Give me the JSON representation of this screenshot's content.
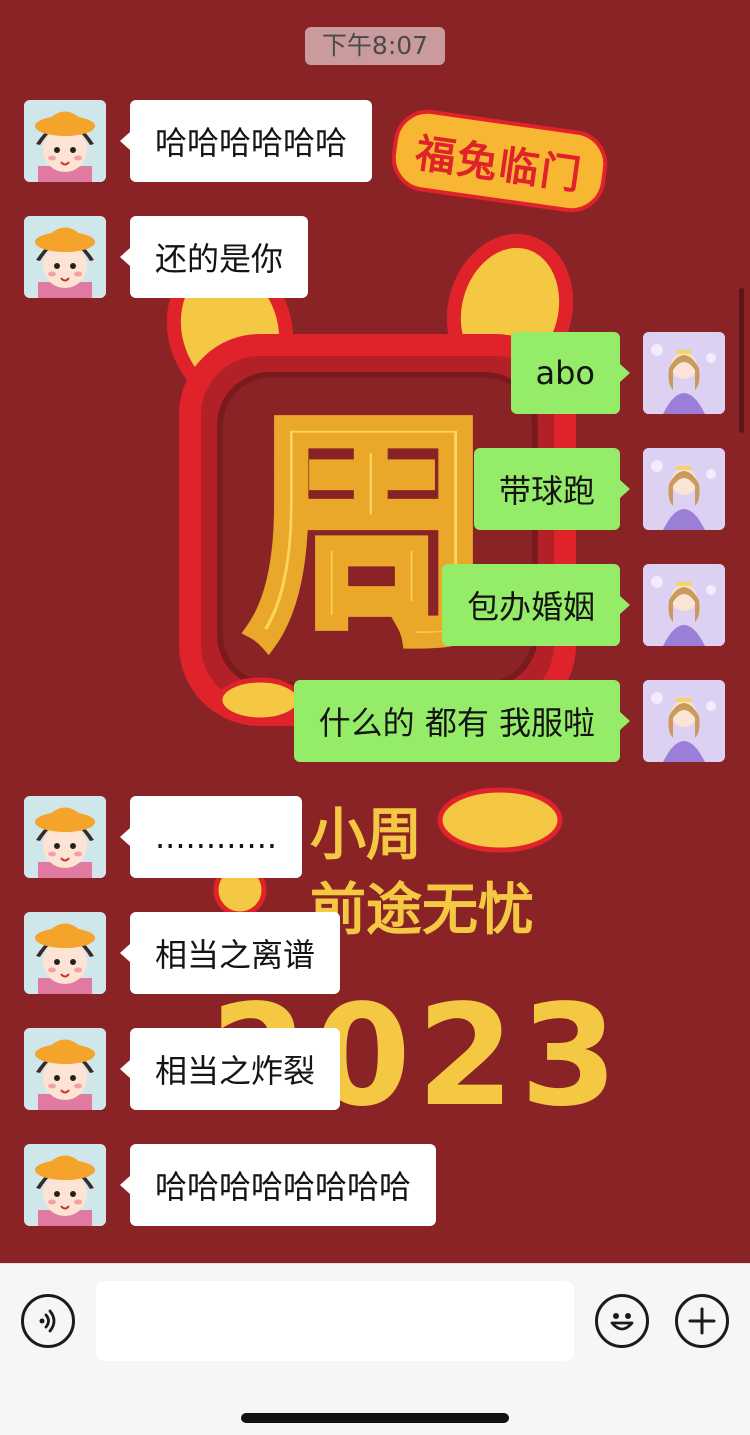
{
  "timestamp": "下午8:07",
  "wallpaper": {
    "badge": "福兔临门",
    "big_char": "周",
    "line1": "小周",
    "line2": "前途无忧",
    "year": "2023"
  },
  "messages": [
    {
      "side": "left",
      "text": "哈哈哈哈哈哈"
    },
    {
      "side": "left",
      "text": "还的是你"
    },
    {
      "side": "right",
      "text": "abo"
    },
    {
      "side": "right",
      "text": "带球跑"
    },
    {
      "side": "right",
      "text": "包办婚姻"
    },
    {
      "side": "right",
      "text": "什么的 都有 我服啦"
    },
    {
      "side": "left",
      "text": "............"
    },
    {
      "side": "left",
      "text": "相当之离谱"
    },
    {
      "side": "left",
      "text": "相当之炸裂"
    },
    {
      "side": "left",
      "text": "哈哈哈哈哈哈哈哈"
    }
  ],
  "input_bar": {
    "voice_icon": "voice-icon",
    "emoji_icon": "emoji-icon",
    "plus_icon": "plus-icon",
    "text_value": ""
  },
  "colors": {
    "background": "#8a2326",
    "bubble_mine": "#95ec69",
    "bubble_other": "#ffffff"
  }
}
